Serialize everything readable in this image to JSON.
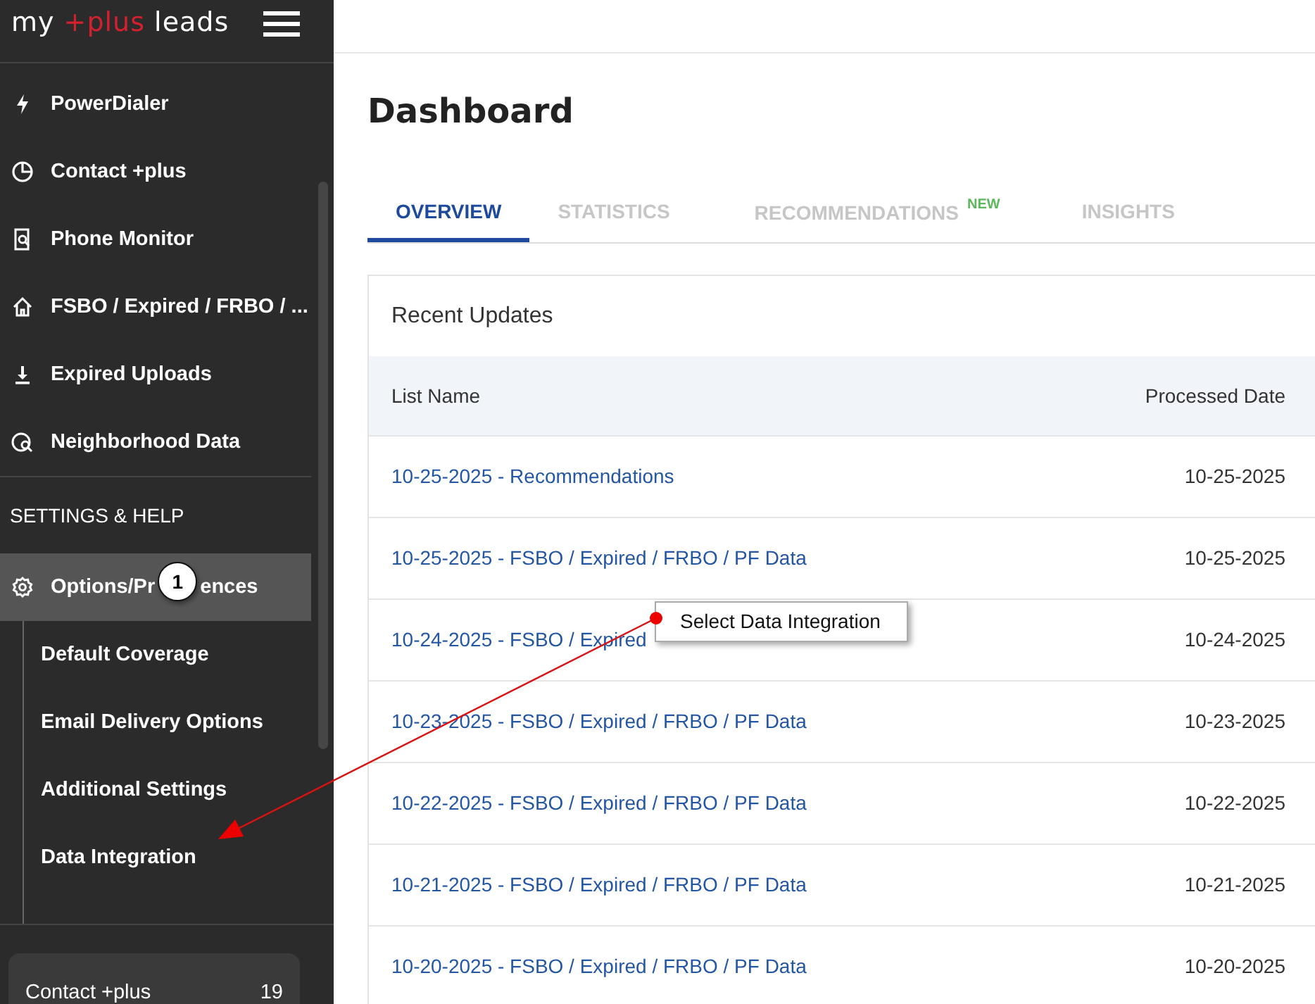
{
  "logo": {
    "prefix": "my",
    "highlight": "+plus",
    "suffix": "leads"
  },
  "sidebar": {
    "items": [
      {
        "label": "PowerDialer",
        "selected": false
      },
      {
        "label": "Contact +plus",
        "selected": false
      },
      {
        "label": "Phone Monitor",
        "selected": false
      },
      {
        "label": "FSBO / Expired / FRBO / ...",
        "selected": false
      },
      {
        "label": "Expired Uploads",
        "selected": false
      },
      {
        "label": "Neighborhood Data",
        "selected": false
      }
    ],
    "section_title": "SETTINGS & HELP",
    "settings_item": {
      "label_parts": [
        "Options/Pr",
        "ences"
      ],
      "selected": true,
      "expanded": true
    },
    "sub_items": [
      {
        "label": "Default Coverage"
      },
      {
        "label": "Email Delivery Options"
      },
      {
        "label": "Additional Settings"
      },
      {
        "label": "Data Integration"
      }
    ],
    "footer": {
      "label": "Contact +plus",
      "count": "19"
    }
  },
  "page_title": "Dashboard",
  "tabs": [
    {
      "label": "OVERVIEW",
      "selected": true
    },
    {
      "label": "STATISTICS",
      "selected": false
    },
    {
      "label": "RECOMMENDATIONS",
      "selected": false,
      "badge": "NEW"
    },
    {
      "label": "INSIGHTS",
      "selected": false
    }
  ],
  "card": {
    "title": "Recent Updates",
    "table": {
      "columns": [
        "List Name",
        "Processed Date"
      ],
      "rows": [
        [
          "10-25-2025 - Recommendations",
          "10-25-2025"
        ],
        [
          "10-25-2025 - FSBO / Expired / FRBO / PF Data",
          "10-25-2025"
        ],
        [
          "10-24-2025 - FSBO / Expired",
          "10-24-2025"
        ],
        [
          "10-23-2025 - FSBO / Expired / FRBO / PF Data",
          "10-23-2025"
        ],
        [
          "10-22-2025 - FSBO / Expired / FRBO / PF Data",
          "10-22-2025"
        ],
        [
          "10-21-2025 - FSBO / Expired / FRBO / PF Data",
          "10-21-2025"
        ],
        [
          "10-20-2025 - FSBO / Expired / FRBO / PF Data",
          "10-20-2025"
        ]
      ]
    }
  },
  "annotations": {
    "step_number": "1",
    "callout": "Select Data Integration"
  }
}
